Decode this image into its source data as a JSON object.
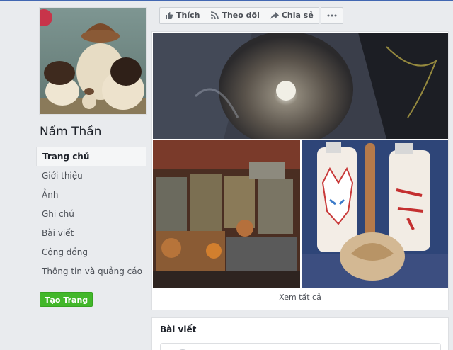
{
  "page": {
    "name": "Nấm Thần"
  },
  "nav": {
    "items": [
      {
        "label": "Trang chủ",
        "active": true
      },
      {
        "label": "Giới thiệu"
      },
      {
        "label": "Ảnh"
      },
      {
        "label": "Ghi chú"
      },
      {
        "label": "Bài viết"
      },
      {
        "label": "Cộng đồng"
      },
      {
        "label": "Thông tin và quảng cáo"
      }
    ],
    "create_page_label": "Tạo Trang"
  },
  "actions": {
    "like": "Thích",
    "follow": "Theo dõi",
    "share": "Chia sẻ",
    "more_icon": "more-dots-icon"
  },
  "photos": {
    "see_all": "Xem tất cả"
  },
  "posts": {
    "title": "Bài viết"
  },
  "colors": {
    "background": "#e9ebee",
    "brand": "#4267b2",
    "create_button": "#42b72a"
  }
}
